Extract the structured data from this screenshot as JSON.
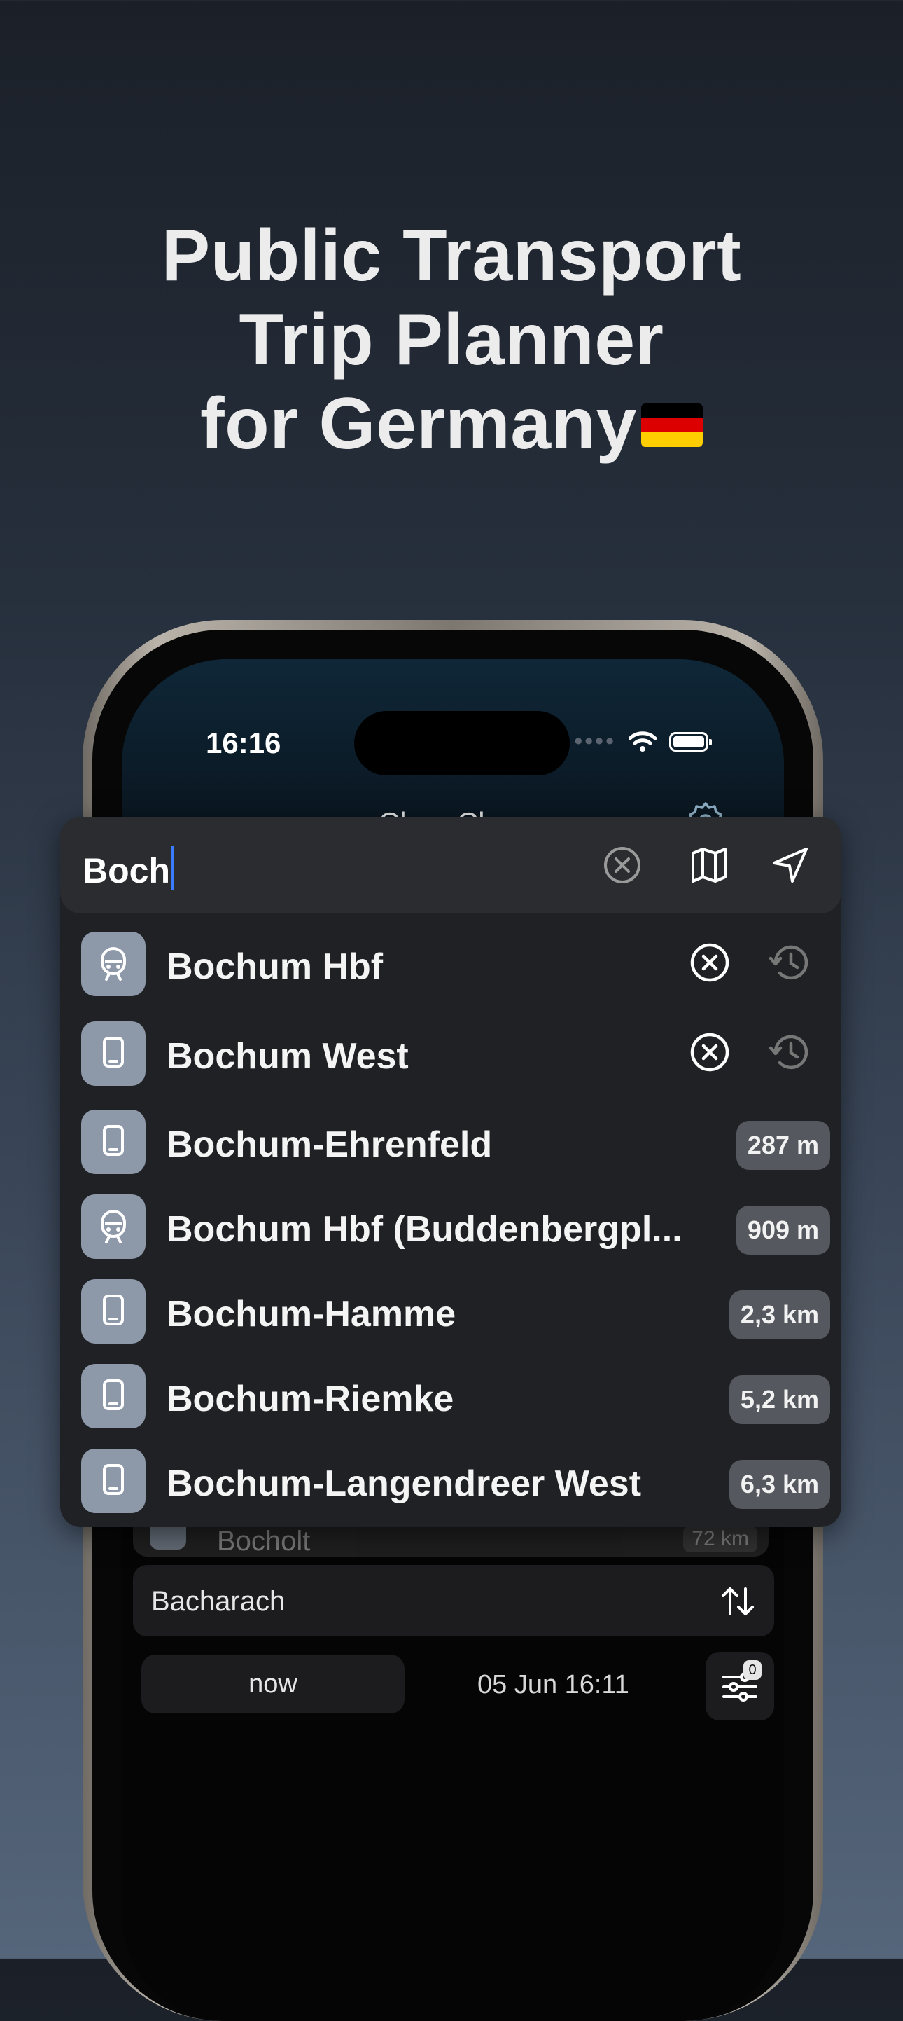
{
  "headline": {
    "line1": "Public Transport",
    "line2": "Trip Planner",
    "line3": "for Germany"
  },
  "status": {
    "time": "16:16"
  },
  "app": {
    "title": "Choo Choo"
  },
  "search": {
    "value": "Boch"
  },
  "recent": [
    {
      "name": "Bochum Hbf",
      "icon": "train-front-icon"
    },
    {
      "name": "Bochum West",
      "icon": "phone-stop-icon"
    }
  ],
  "results": [
    {
      "name": "Bochum-Ehrenfeld",
      "distance": "287 m",
      "icon": "phone-stop-icon"
    },
    {
      "name": "Bochum Hbf (Buddenbergpl...",
      "distance": "909 m",
      "icon": "train-front-icon"
    },
    {
      "name": "Bochum-Hamme",
      "distance": "2,3 km",
      "icon": "phone-stop-icon"
    },
    {
      "name": "Bochum-Riemke",
      "distance": "5,2 km",
      "icon": "phone-stop-icon"
    },
    {
      "name": "Bochum-Langendreer West",
      "distance": "6,3 km",
      "icon": "phone-stop-icon"
    }
  ],
  "behind": {
    "partial_row": {
      "name": "Bocholt",
      "distance": "72 km"
    },
    "destination": "Bacharach",
    "time_mode": "now",
    "datetime": "05 Jun 16:11",
    "filter_count": "0"
  },
  "colors": {
    "accent_caret": "#3a7bff",
    "stop_icon_bg": "#8d98a8"
  }
}
